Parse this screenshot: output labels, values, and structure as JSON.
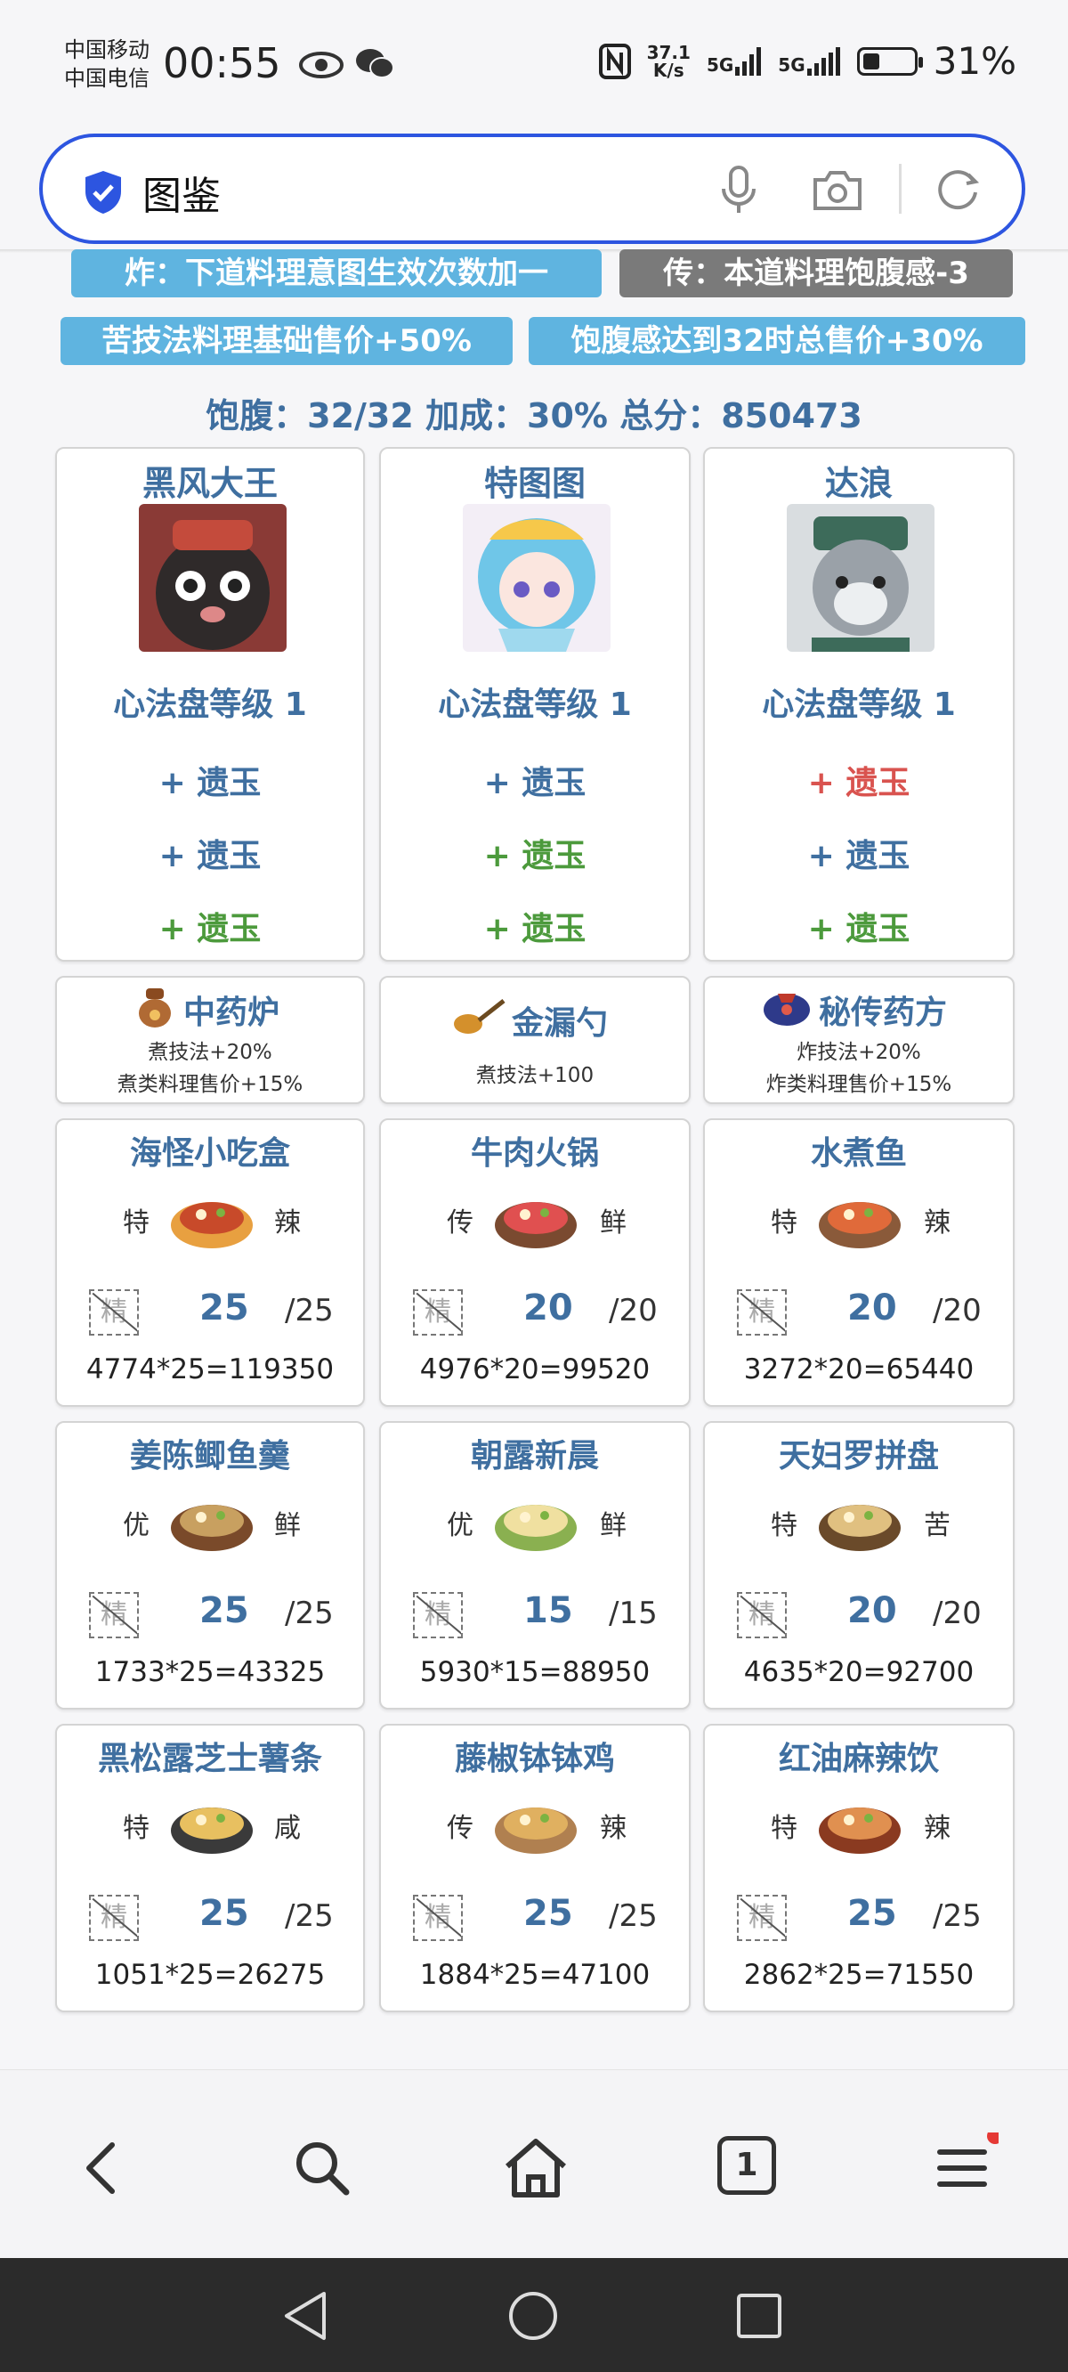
{
  "status": {
    "carrier1": "中国移动",
    "carrier2": "中国电信",
    "time": "00:55",
    "net_speed": "37.1\nK/s",
    "net1": "5G",
    "net2": "5G",
    "battery": "31%"
  },
  "search": {
    "query": "图鉴"
  },
  "effects": [
    "炸：下道料理意图生效次数加一",
    "传：本道料理饱腹感-3",
    "苦技法料理基础售价+50%",
    "饱腹感达到32时总售价+30%"
  ],
  "summary": "饱腹：32/32 加成：30% 总分：850473",
  "characters": [
    {
      "name": "黑风大王",
      "level": "心法盘等级 1",
      "jades": [
        "+ 遗玉",
        "+ 遗玉",
        "+ 遗玉"
      ],
      "jade_colors": [
        "blue",
        "blue",
        "green"
      ]
    },
    {
      "name": "特图图",
      "level": "心法盘等级 1",
      "jades": [
        "+ 遗玉",
        "+ 遗玉",
        "+ 遗玉"
      ],
      "jade_colors": [
        "blue",
        "green",
        "green"
      ]
    },
    {
      "name": "达浪",
      "level": "心法盘等级 1",
      "jades": [
        "+ 遗玉",
        "+ 遗玉",
        "+ 遗玉"
      ],
      "jade_colors": [
        "red",
        "blue",
        "green"
      ]
    }
  ],
  "tools": [
    {
      "name": "中药炉",
      "desc1": "煮技法+20%",
      "desc2": "煮类料理售价+15%"
    },
    {
      "name": "金漏勺",
      "desc1": "煮技法+100",
      "desc2": ""
    },
    {
      "name": "秘传药方",
      "desc1": "炸技法+20%",
      "desc2": "炸类料理售价+15%"
    }
  ],
  "dishes": [
    {
      "name": "海怪小吃盒",
      "left": "特",
      "right": "辣",
      "jing": "精",
      "qty": "25",
      "max": "/25",
      "formula": "4774*25=119350"
    },
    {
      "name": "牛肉火锅",
      "left": "传",
      "right": "鲜",
      "jing": "精",
      "qty": "20",
      "max": "/20",
      "formula": "4976*20=99520"
    },
    {
      "name": "水煮鱼",
      "left": "特",
      "right": "辣",
      "jing": "精",
      "qty": "20",
      "max": "/20",
      "formula": "3272*20=65440"
    },
    {
      "name": "姜陈鲫鱼羹",
      "left": "优",
      "right": "鲜",
      "jing": "精",
      "qty": "25",
      "max": "/25",
      "formula": "1733*25=43325"
    },
    {
      "name": "朝露新晨",
      "left": "优",
      "right": "鲜",
      "jing": "精",
      "qty": "15",
      "max": "/15",
      "formula": "5930*15=88950"
    },
    {
      "name": "天妇罗拼盘",
      "left": "特",
      "right": "苦",
      "jing": "精",
      "qty": "20",
      "max": "/20",
      "formula": "4635*20=92700"
    },
    {
      "name": "黑松露芝士薯条",
      "left": "特",
      "right": "咸",
      "jing": "精",
      "qty": "25",
      "max": "/25",
      "formula": "1051*25=26275"
    },
    {
      "name": "藤椒钵钵鸡",
      "left": "传",
      "right": "辣",
      "jing": "精",
      "qty": "25",
      "max": "/25",
      "formula": "1884*25=47100"
    },
    {
      "name": "红油麻辣饮",
      "left": "特",
      "right": "辣",
      "jing": "精",
      "qty": "25",
      "max": "/25",
      "formula": "2862*25=71550"
    }
  ],
  "nav": {
    "tab_count": "1"
  }
}
